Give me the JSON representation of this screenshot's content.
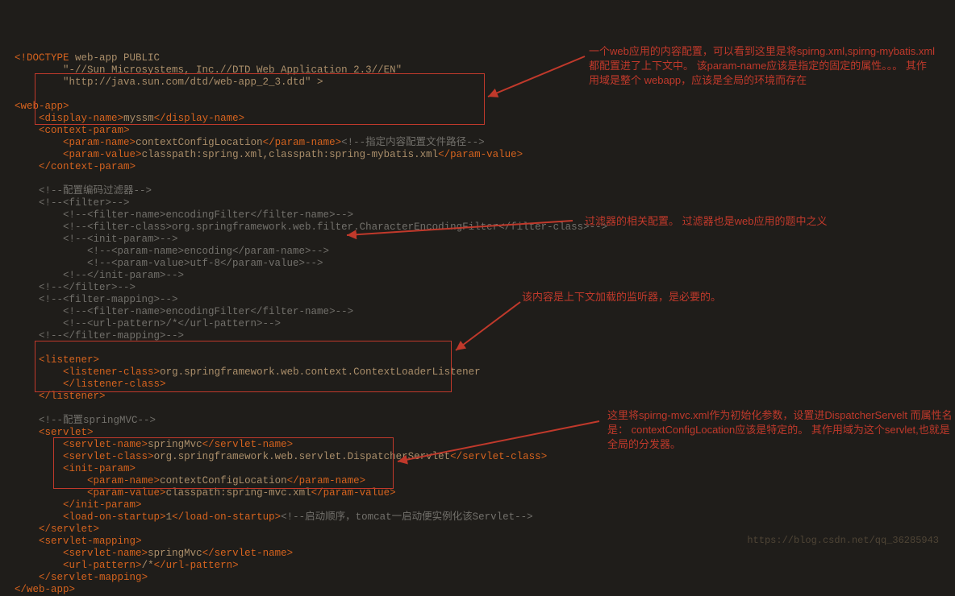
{
  "code": {
    "doctype_kw": "<!DOCTYPE ",
    "doctype_body": "web-app PUBLIC\n        \"-//Sun Microsystems, Inc.//DTD Web Application 2.3//EN\"\n        \"http://java.sun.com/dtd/web-app_2_3.dtd\" >",
    "webapp_open": "web-app",
    "display_name_tag": "display-name",
    "display_name_val": "myssm",
    "context_param_tag": "context-param",
    "param_name_tag": "param-name",
    "param_value_tag": "param-value",
    "ctx_param_name": "contextConfigLocation",
    "ctx_param_comment": "<!--指定内容配置文件路径-->",
    "ctx_param_value": "classpath:spring.xml,classpath:spring-mybatis.xml",
    "filter_header_cmt": "<!--配置编码过滤器-->",
    "filter_block": "    <!--<filter>-->\n        <!--<filter-name>encodingFilter</filter-name>-->\n        <!--<filter-class>org.springframework.web.filter.CharacterEncodingFilter</filter-class>-->\n        <!--<init-param>-->\n            <!--<param-name>encoding</param-name>-->\n            <!--<param-value>utf-8</param-value>-->\n        <!--</init-param>-->\n    <!--</filter>-->\n    <!--<filter-mapping>-->\n        <!--<filter-name>encodingFilter</filter-name>-->\n        <!--<url-pattern>/*</url-pattern>-->\n    <!--</filter-mapping>-->",
    "listener_tag": "listener",
    "listener_class_tag": "listener-class",
    "listener_class_val": "org.springframework.web.context.ContextLoaderListener",
    "springmvc_cmt": "<!--配置springMVC-->",
    "servlet_tag": "servlet",
    "servlet_name_tag": "servlet-name",
    "servlet_name_val": "springMvc",
    "servlet_class_tag": "servlet-class",
    "servlet_class_val": "org.springframework.web.servlet.DispatcherServlet",
    "init_param_tag": "init-param",
    "init_param_name": "contextConfigLocation",
    "init_param_value": "classpath:spring-mvc.xml",
    "load_on_startup_tag": "load-on-startup",
    "load_on_startup_val": "1",
    "load_cmt": "<!--启动顺序，tomcat一启动便实例化该Servlet-->",
    "servlet_mapping_tag": "servlet-mapping",
    "url_pattern_tag": "url-pattern",
    "url_pattern_val": "/*"
  },
  "annotations": {
    "a1": "一个web应用的内容配置，可以看到这里是将spirng.xml,spirng-mybatis.xml都配置进了上下文中。\n    该param-name应该是指定的固定的属性。。。\n    其作用域是整个 webapp，应该是全局的环境而存在",
    "a2": "过滤器的相关配置。 过滤器也是web应用的题中之义",
    "a3": "该内容是上下文加载的监听器，是必要的。",
    "a4": "这里将spirng-mvc.xml作为初始化参数，设置进DispatcherServelt\n    而属性名是：  contextConfigLocation应该是特定的。\n其作用域为这个servlet,也就是全局的分发器。"
  },
  "watermark": "https://blog.csdn.net/qq_36285943"
}
